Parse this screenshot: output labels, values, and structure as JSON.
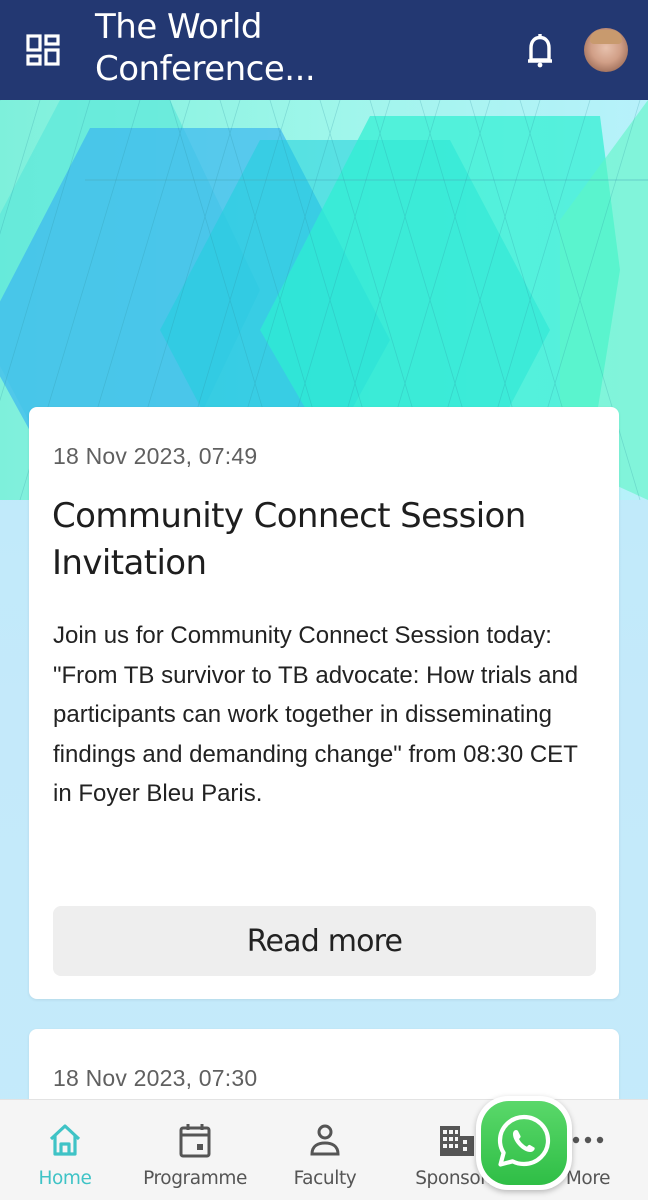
{
  "header": {
    "title": "The World Conference...",
    "menu_icon": "dashboard-grid-icon",
    "notification_icon": "bell-icon",
    "avatar_icon": "user-avatar"
  },
  "banner": {
    "colors": {
      "teal": "#2ef0d0",
      "cyan": "#1ccfe6",
      "blue": "#3bb6ef",
      "mint": "#6ff3c6"
    }
  },
  "feed": [
    {
      "date": "18 Nov 2023, 07:49",
      "title": "Community Connect Session Invitation",
      "body": "Join us for Community Connect Session today: \"From TB survivor to TB advocate: How trials and participants can work together in disseminating findings and demanding change\" from 08:30 CET in Foyer Bleu Paris.",
      "button_label": "Read more"
    },
    {
      "date": "18 Nov 2023, 07:30"
    }
  ],
  "bottom_nav": {
    "items": [
      {
        "label": "Home",
        "icon": "home-icon",
        "active": true
      },
      {
        "label": "Programme",
        "icon": "calendar-icon",
        "active": false
      },
      {
        "label": "Faculty",
        "icon": "person-icon",
        "active": false
      },
      {
        "label": "Sponsors",
        "icon": "building-icon",
        "active": false
      },
      {
        "label": "More",
        "icon": "more-dots-icon",
        "active": false
      }
    ],
    "active_color": "#3fc3c6",
    "inactive_color": "#555555"
  },
  "fab": {
    "icon": "whatsapp-icon",
    "color": "#2fbe46"
  }
}
